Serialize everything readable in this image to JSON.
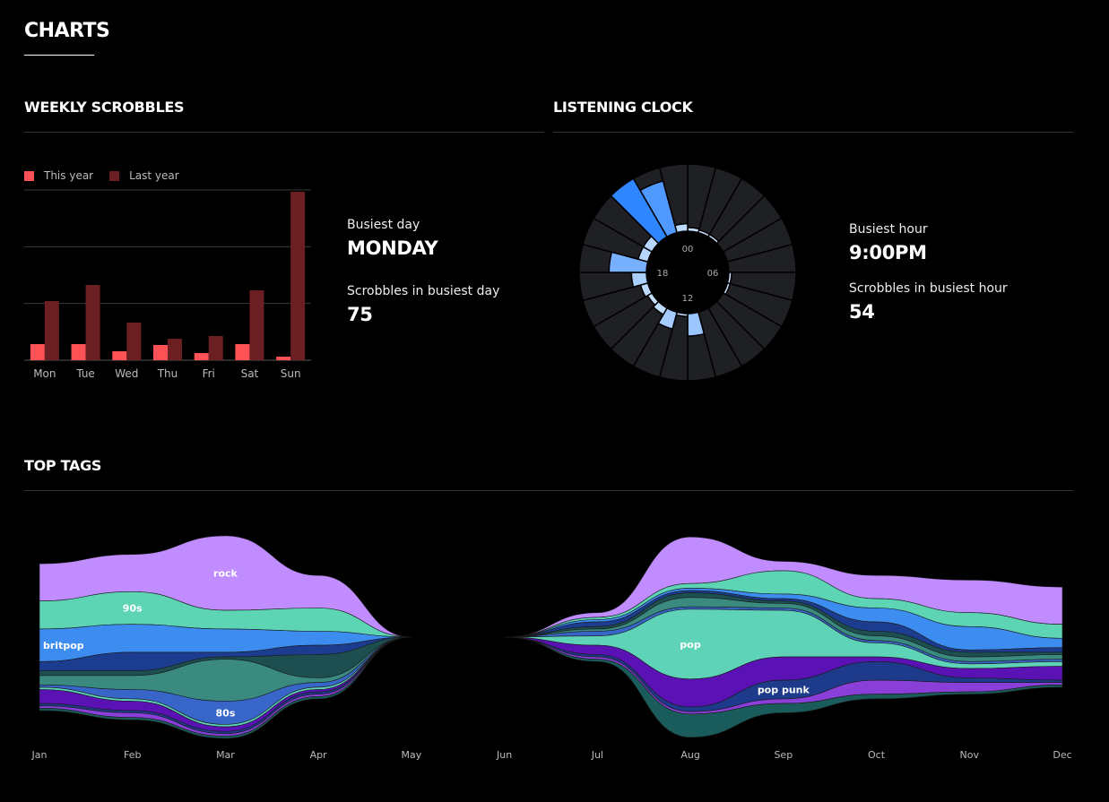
{
  "page": {
    "title": "CHARTS"
  },
  "weekly": {
    "title": "WEEKLY SCROBBLES",
    "legend": {
      "this_year": "This year",
      "last_year": "Last year"
    },
    "colors": {
      "this_year": "#ff5256",
      "last_year": "#6b1f22"
    },
    "stats": {
      "busiest_label": "Busiest day",
      "busiest_value": "MONDAY",
      "count_label": "Scrobbles in busiest day",
      "count_value": "75"
    }
  },
  "clock": {
    "title": "LISTENING CLOCK",
    "hour_labels": {
      "top": "00",
      "right": "06",
      "bottom": "12",
      "left": "18"
    },
    "stats": {
      "busiest_label": "Busiest hour",
      "busiest_value": "9:00PM",
      "count_label": "Scrobbles in busiest hour",
      "count_value": "54"
    }
  },
  "tags": {
    "title": "TOP TAGS"
  },
  "chart_data": [
    {
      "type": "bar",
      "categories": [
        "Mon",
        "Tue",
        "Wed",
        "Thu",
        "Fri",
        "Sat",
        "Sun"
      ],
      "series": [
        {
          "name": "This year",
          "values": [
            9,
            9,
            5,
            8.5,
            4,
            9,
            2
          ]
        },
        {
          "name": "Last year",
          "values": [
            33,
            42,
            21,
            12,
            13.5,
            39,
            94
          ]
        }
      ],
      "ylim": [
        0,
        95
      ],
      "grid": true,
      "legend": "top-left"
    },
    {
      "type": "bar",
      "subtype": "radial",
      "categories": [
        "00",
        "01",
        "02",
        "03",
        "04",
        "05",
        "06",
        "07",
        "08",
        "09",
        "10",
        "11",
        "12",
        "13",
        "14",
        "15",
        "16",
        "17",
        "18",
        "19",
        "20",
        "21",
        "22",
        "23"
      ],
      "values": [
        3,
        1,
        1,
        0,
        0,
        0,
        1,
        1,
        0,
        0,
        0,
        18,
        2,
        14,
        6,
        4,
        6,
        12,
        30,
        8,
        8,
        54,
        43,
        6
      ],
      "max": 54,
      "colors": [
        "#cfe4ff",
        "#2f86ff"
      ],
      "track_color": "#1f2024"
    },
    {
      "type": "area",
      "subtype": "streamgraph",
      "x": [
        "Jan",
        "Feb",
        "Mar",
        "Apr",
        "May",
        "Jun",
        "Jul",
        "Aug",
        "Sep",
        "Oct",
        "Nov",
        "Dec"
      ],
      "series": [
        {
          "name": "rock",
          "color": "#c08cff",
          "values": [
            0.8,
            0.8,
            1.6,
            0.7,
            0,
            0,
            0.1,
            1.0,
            0.2,
            0.5,
            0.7,
            0.8
          ]
        },
        {
          "name": "90s",
          "color": "#5dd4b4",
          "values": [
            0.6,
            0.7,
            0.4,
            0.5,
            0,
            0,
            0.05,
            0.1,
            0.5,
            0.2,
            0.3,
            0.3
          ]
        },
        {
          "name": "britpop",
          "color": "#3d8cf0",
          "values": [
            0.7,
            0.6,
            0.5,
            0.3,
            0,
            0,
            0.05,
            0.05,
            0.1,
            0.3,
            0.5,
            0.2
          ]
        },
        {
          "name": "",
          "color": "#1c3d8f",
          "values": [
            0.2,
            0.4,
            0.1,
            0.2,
            0,
            0,
            0.1,
            0.05,
            0.05,
            0.2,
            0.05,
            0.1
          ]
        },
        {
          "name": "",
          "color": "#1e4f50",
          "values": [
            0.1,
            0.1,
            0.05,
            0.5,
            0,
            0,
            0.05,
            0.1,
            0.05,
            0.1,
            0.1,
            0.05
          ]
        },
        {
          "name": "",
          "color": "#3a8a80",
          "values": [
            0.2,
            0.3,
            0.9,
            0.1,
            0,
            0,
            0.05,
            0.2,
            0.1,
            0.1,
            0.1,
            0.1
          ]
        },
        {
          "name": "80s",
          "color": "#3766c8",
          "values": [
            0.05,
            0.2,
            0.5,
            0.1,
            0,
            0,
            0.1,
            0.05,
            0.05,
            0.05,
            0.05,
            0.05
          ]
        },
        {
          "name": "pop",
          "color": "#5fd3b8",
          "values": [
            0.05,
            0.05,
            0.05,
            0.05,
            0,
            0,
            0.2,
            1.5,
            1.0,
            0.3,
            0.1,
            0.1
          ]
        },
        {
          "name": "",
          "color": "#5a12b5",
          "values": [
            0.3,
            0.2,
            0.1,
            0.05,
            0,
            0,
            0.2,
            0.6,
            0.5,
            0.1,
            0.2,
            0.3
          ]
        },
        {
          "name": "pop punk",
          "color": "#1e3a8a",
          "values": [
            0.05,
            0.05,
            0.05,
            0.05,
            0,
            0,
            0.05,
            0.1,
            0.4,
            0.4,
            0.1,
            0.05
          ]
        },
        {
          "name": "",
          "color": "#8b3fd9",
          "values": [
            0.05,
            0.1,
            0.05,
            0.05,
            0,
            0,
            0.05,
            0.05,
            0.1,
            0.3,
            0.2,
            0.05
          ]
        },
        {
          "name": "",
          "color": "#1a5c5c",
          "values": [
            0.05,
            0.05,
            0.05,
            0.05,
            0,
            0,
            0.05,
            0.5,
            0.2,
            0.1,
            0.05,
            0.05
          ]
        }
      ]
    }
  ]
}
